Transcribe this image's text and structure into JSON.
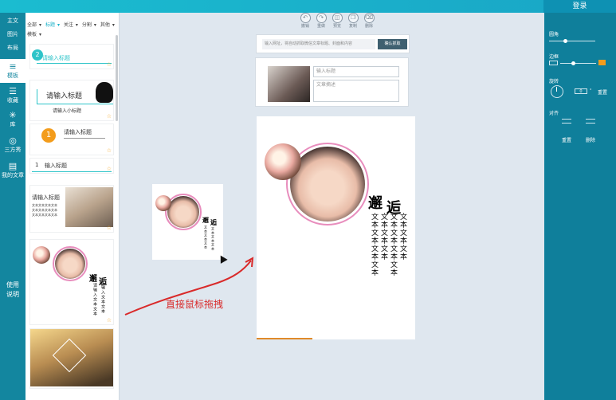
{
  "topbar": {
    "login": "登录"
  },
  "nav": {
    "top_items": [
      "主文",
      "图片",
      "布局"
    ],
    "blocks": [
      {
        "icon": "≡",
        "label": "模板"
      },
      {
        "icon": "☰",
        "label": "收藏"
      },
      {
        "icon": "✳",
        "label": "库"
      },
      {
        "icon": "◎",
        "label": "三方秀"
      },
      {
        "icon": "▤",
        "label": "我的文章"
      }
    ],
    "help_line1": "使用",
    "help_line2": "说明"
  },
  "templates": {
    "filters": [
      "全部",
      "标题",
      "关注",
      "分割",
      "其他",
      "模板"
    ],
    "card1_title": "请输入标题",
    "card2_title": "请输入标题",
    "card2_sub": "请输入小标题",
    "card3_title": "请输入标题",
    "card4_title": "输入标题",
    "card5_title": "请输入标题",
    "card5_body": "文本文本文本文本文本文本文本文本文本文本文本文本",
    "card6_title1": "邂",
    "card6_title2": "逅",
    "card6_col1": "输入文本文本",
    "card6_col2": "请输入文本文本"
  },
  "toolbar": [
    "撤销",
    "重做",
    "预览",
    "复制",
    "删除"
  ],
  "import": {
    "placeholder": "输入网址，将自动抓取微信文章标题、封面和内容",
    "button": "确认抓取"
  },
  "article": {
    "title_placeholder": "输入标题",
    "summary_placeholder": "文章摘述"
  },
  "canvas": {
    "title1": "邂",
    "title2": "逅",
    "cols": [
      "文本文本文本",
      "文本文本文本",
      "文本文本文本文本",
      "文本文本文本文本"
    ]
  },
  "mini": {
    "title1": "邂",
    "title2": "逅",
    "cols": [
      "文本文本文本",
      "文本文本文本"
    ]
  },
  "annotation": "直接鼠标拖拽",
  "rightpanel": {
    "corner": "圆角",
    "border": "边框",
    "rotate": "旋转",
    "rotate_value": "0",
    "reset": "重置",
    "align": "对齐",
    "reset2": "重置",
    "delete": "删除"
  },
  "colors": {
    "accent": "#19b1c9",
    "nav": "#13869f",
    "panel": "#0f7f9b",
    "annotation": "#d92a2a",
    "progress": "#e08a2a"
  }
}
